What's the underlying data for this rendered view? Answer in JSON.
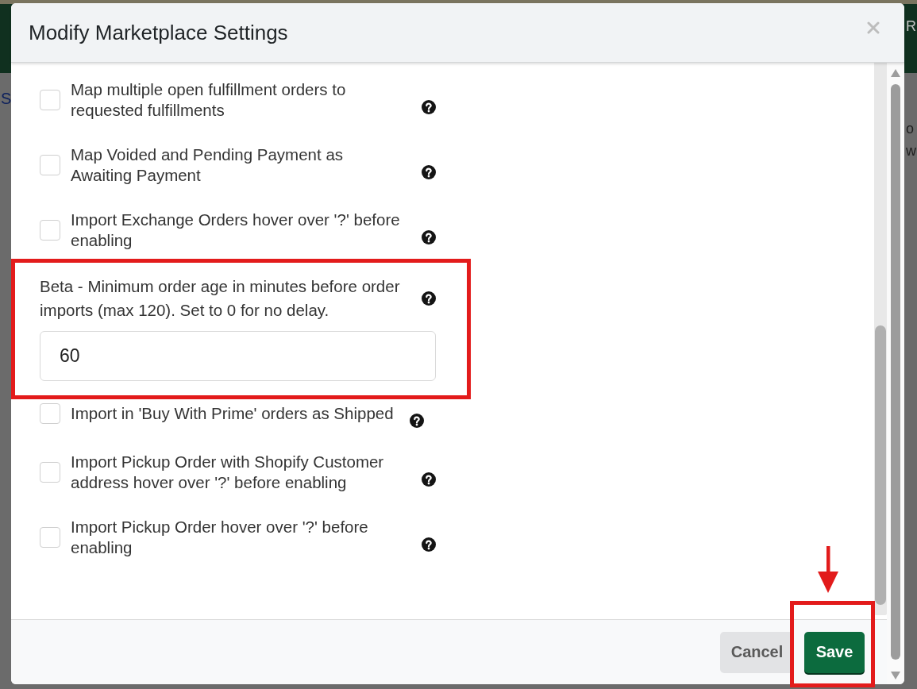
{
  "backdrop": {
    "header_text": "R",
    "left_text": "S",
    "right_texts": [
      "o",
      "w"
    ]
  },
  "dialog": {
    "title": "Modify Marketplace Settings",
    "settings": [
      {
        "kind": "checkbox",
        "label": "Map multiple open fulfillment orders to requested fulfillments",
        "checked": false,
        "highlighted": false
      },
      {
        "kind": "checkbox",
        "label": "Map Voided and Pending Payment as Awaiting Payment",
        "checked": false,
        "highlighted": false
      },
      {
        "kind": "checkbox",
        "label": "Import Exchange Orders hover over '?' before enabling",
        "checked": false,
        "highlighted": false
      },
      {
        "kind": "number",
        "label": "Beta - Minimum order age in minutes before order imports (max 120). Set to 0 for no delay.",
        "value": "60",
        "highlighted": true
      },
      {
        "kind": "checkbox",
        "label": "Import in 'Buy With Prime' orders as Shipped",
        "checked": false,
        "highlighted": false
      },
      {
        "kind": "checkbox",
        "label": "Import Pickup Order with Shopify Customer address hover over '?' before enabling",
        "checked": false,
        "highlighted": false
      },
      {
        "kind": "checkbox",
        "label": "Import Pickup Order hover over '?' before enabling",
        "checked": false,
        "highlighted": false
      }
    ],
    "buttons": [
      {
        "kind": "secondary",
        "label": "Cancel",
        "highlighted": false,
        "arrow": false
      },
      {
        "kind": "primary",
        "label": "Save",
        "highlighted": true,
        "arrow": true
      }
    ]
  }
}
